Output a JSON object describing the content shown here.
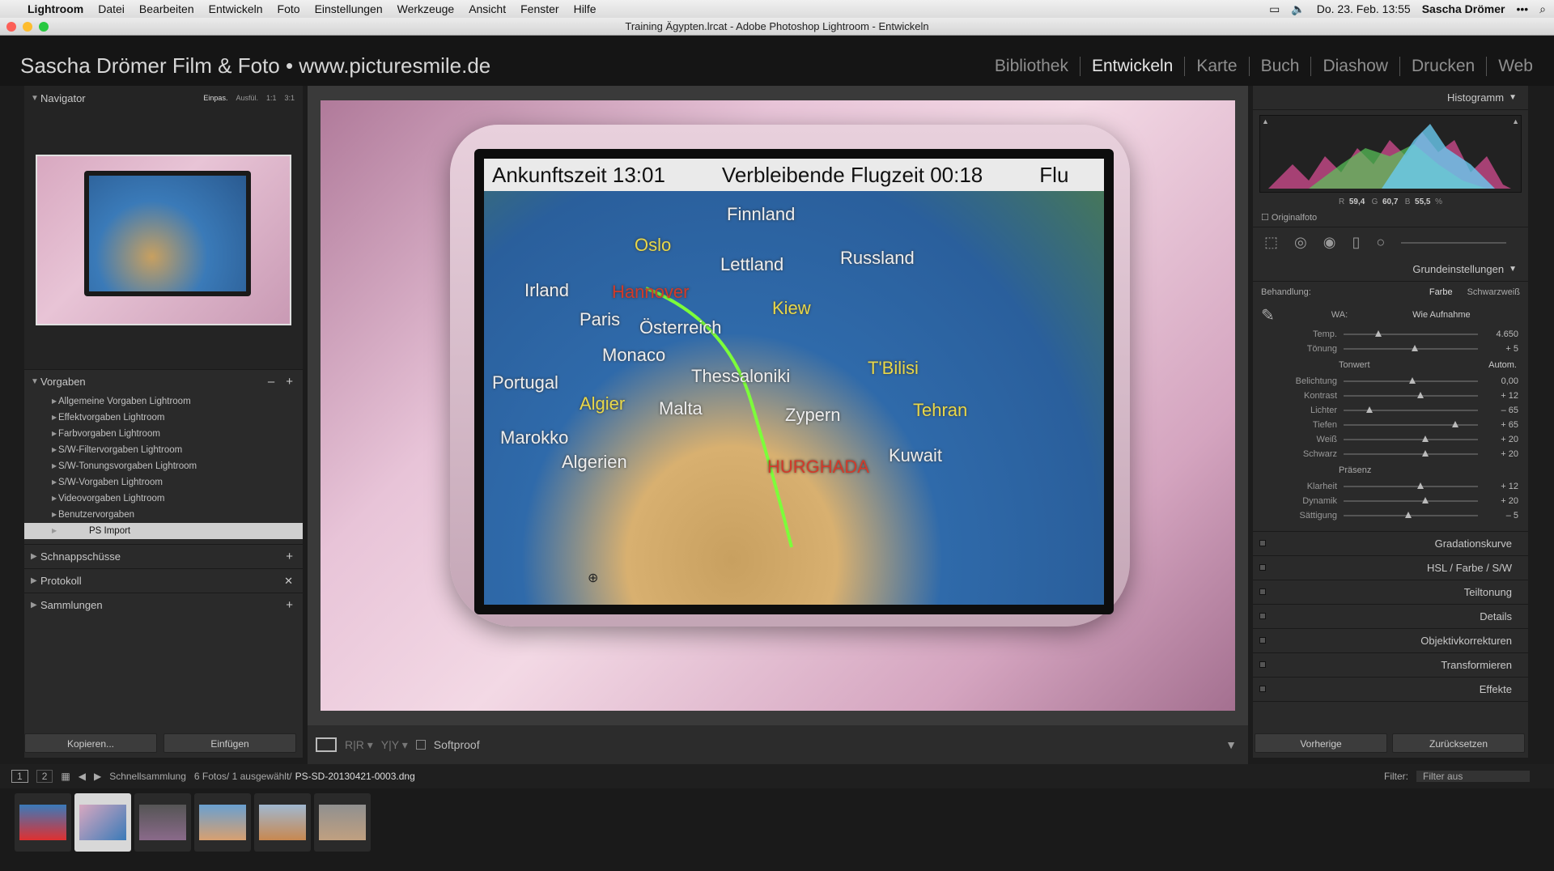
{
  "menubar": {
    "app": "Lightroom",
    "items": [
      "Datei",
      "Bearbeiten",
      "Entwickeln",
      "Foto",
      "Einstellungen",
      "Werkzeuge",
      "Ansicht",
      "Fenster",
      "Hilfe"
    ],
    "datetime": "Do. 23. Feb. 13:55",
    "user": "Sascha Drömer"
  },
  "window": {
    "title": "Training Ägypten.lrcat - Adobe Photoshop Lightroom - Entwickeln"
  },
  "identity": {
    "plate": "Sascha Drömer Film & Foto • www.picturesmile.de",
    "modules": [
      "Bibliothek",
      "Entwickeln",
      "Karte",
      "Buch",
      "Diashow",
      "Drucken",
      "Web"
    ],
    "active_module": "Entwickeln"
  },
  "left": {
    "navigator": {
      "title": "Navigator",
      "zoom_options": [
        "Einpas.",
        "Ausfül.",
        "1:1",
        "3:1"
      ]
    },
    "presets": {
      "title": "Vorgaben",
      "items": [
        "Allgemeine Vorgaben Lightroom",
        "Effektvorgaben Lightroom",
        "Farbvorgaben Lightroom",
        "S/W-Filtervorgaben Lightroom",
        "S/W-Tonungsvorgaben Lightroom",
        "S/W-Vorgaben Lightroom",
        "Videovorgaben Lightroom",
        "Benutzervorgaben"
      ],
      "selected": "PS Import"
    },
    "snapshots": "Schnappschüsse",
    "history": "Protokoll",
    "collections": "Sammlungen",
    "copy_btn": "Kopieren...",
    "paste_btn": "Einfügen"
  },
  "photo_text": {
    "arrival": "Ankunftszeit 13:01",
    "remaining": "Verbleibende Flugzeit 00:18",
    "cut": "Flu",
    "cities": [
      "Finnland",
      "Oslo",
      "Lettland",
      "Russland",
      "Irland",
      "Hannover",
      "Kiew",
      "Paris",
      "Österreich",
      "Monaco",
      "Thessaloniki",
      "T'Bilisi",
      "Portugal",
      "Algier",
      "Malta",
      "Zypern",
      "Tehran",
      "Marokko",
      "Algerien",
      "HURGHADA",
      "Kuwait"
    ]
  },
  "toolbar": {
    "softproof": "Softproof"
  },
  "right": {
    "histogram": {
      "title": "Histogramm",
      "r_label": "R",
      "r": "59,4",
      "g_label": "G",
      "g": "60,7",
      "b_label": "B",
      "b": "55,5",
      "unit": "%",
      "original": "Originalfoto"
    },
    "basic": {
      "title": "Grundeinstellungen",
      "treatment_label": "Behandlung:",
      "color": "Farbe",
      "bw": "Schwarzweiß",
      "wb_label": "WA:",
      "wb_value": "Wie Aufnahme",
      "tone_label": "Tonwert",
      "auto": "Autom.",
      "presence_label": "Präsenz",
      "sliders": [
        {
          "label": "Temp.",
          "value": "4.650",
          "pos": 0.24
        },
        {
          "label": "Tönung",
          "value": "+ 5",
          "pos": 0.52
        },
        {
          "label": "Belichtung",
          "value": "0,00",
          "pos": 0.5
        },
        {
          "label": "Kontrast",
          "value": "+ 12",
          "pos": 0.56
        },
        {
          "label": "Lichter",
          "value": "– 65",
          "pos": 0.17
        },
        {
          "label": "Tiefen",
          "value": "+ 65",
          "pos": 0.83
        },
        {
          "label": "Weiß",
          "value": "+ 20",
          "pos": 0.6
        },
        {
          "label": "Schwarz",
          "value": "+ 20",
          "pos": 0.6
        },
        {
          "label": "Klarheit",
          "value": "+ 12",
          "pos": 0.56
        },
        {
          "label": "Dynamik",
          "value": "+ 20",
          "pos": 0.6
        },
        {
          "label": "Sättigung",
          "value": "– 5",
          "pos": 0.47
        }
      ]
    },
    "panels": [
      "Gradationskurve",
      "HSL / Farbe / S/W",
      "Teiltonung",
      "Details",
      "Objektivkorrekturen",
      "Transformieren",
      "Effekte"
    ],
    "prev_btn": "Vorherige",
    "reset_btn": "Zurücksetzen"
  },
  "filmbar": {
    "view1": "1",
    "view2": "2",
    "source": "Schnellsammlung",
    "count": "6 Fotos/ 1 ausgewählt/",
    "filename": "PS-SD-20130421-0003.dng",
    "filter_label": "Filter:",
    "filter_value": "Filter aus"
  },
  "film": {
    "thumb_count": 6,
    "selected_index": 1
  },
  "colors": {
    "accent": "#e6e6e6",
    "panel": "#2a2a2a",
    "route": "#7cff3a"
  }
}
